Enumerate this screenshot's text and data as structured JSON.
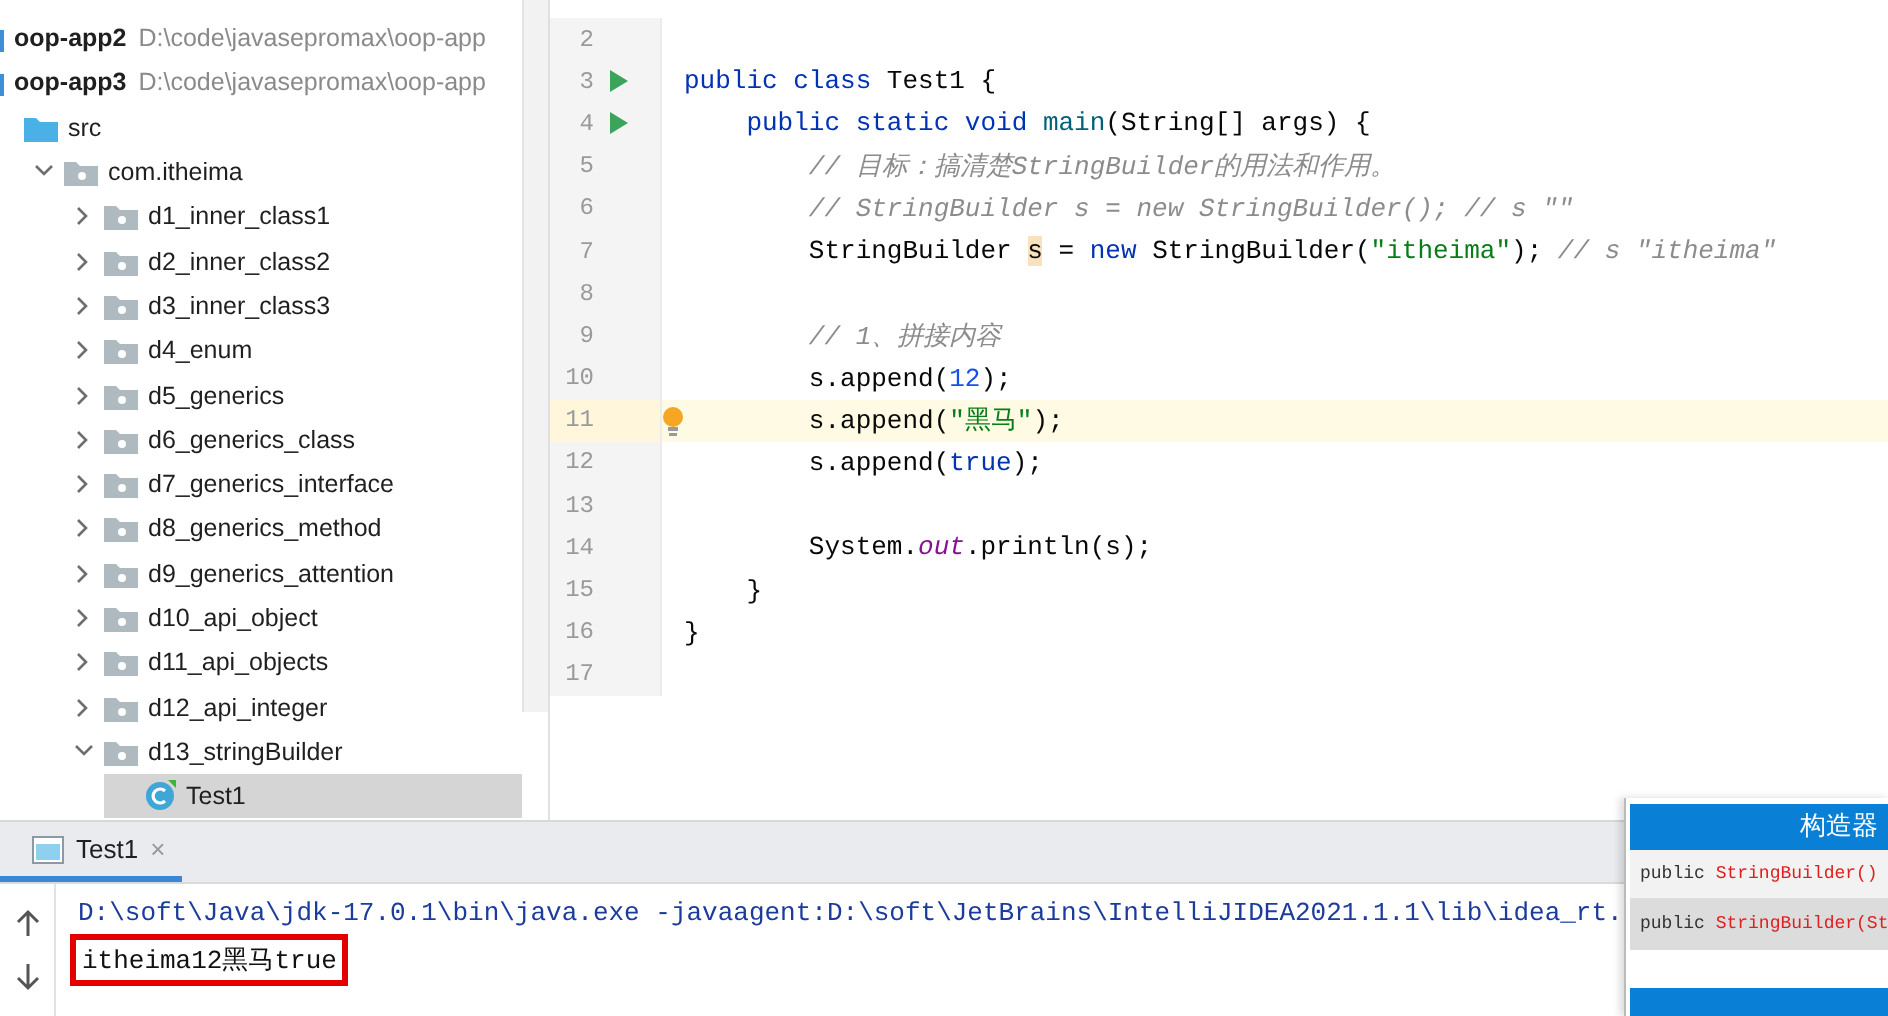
{
  "project_tree": [
    {
      "name": "oop-app2",
      "path": "D:\\code\\javasepromax\\oop-app",
      "kind": "module"
    },
    {
      "name": "oop-app3",
      "path": "D:\\code\\javasepromax\\oop-app",
      "kind": "module",
      "children": [
        {
          "name": "src",
          "kind": "source",
          "children": [
            {
              "name": "com.itheima",
              "kind": "package",
              "expanded": true,
              "children": [
                {
                  "name": "d1_inner_class1",
                  "kind": "package",
                  "expanded": false
                },
                {
                  "name": "d2_inner_class2",
                  "kind": "package",
                  "expanded": false
                },
                {
                  "name": "d3_inner_class3",
                  "kind": "package",
                  "expanded": false
                },
                {
                  "name": "d4_enum",
                  "kind": "package",
                  "expanded": false
                },
                {
                  "name": "d5_generics",
                  "kind": "package",
                  "expanded": false
                },
                {
                  "name": "d6_generics_class",
                  "kind": "package",
                  "expanded": false
                },
                {
                  "name": "d7_generics_interface",
                  "kind": "package",
                  "expanded": false
                },
                {
                  "name": "d8_generics_method",
                  "kind": "package",
                  "expanded": false
                },
                {
                  "name": "d9_generics_attention",
                  "kind": "package",
                  "expanded": false
                },
                {
                  "name": "d10_api_object",
                  "kind": "package",
                  "expanded": false
                },
                {
                  "name": "d11_api_objects",
                  "kind": "package",
                  "expanded": false
                },
                {
                  "name": "d12_api_integer",
                  "kind": "package",
                  "expanded": false
                },
                {
                  "name": "d13_stringBuilder",
                  "kind": "package",
                  "expanded": true,
                  "children": [
                    {
                      "name": "Test1",
                      "kind": "class",
                      "selected": true
                    }
                  ]
                }
              ]
            }
          ]
        }
      ]
    }
  ],
  "editor": {
    "lines": [
      {
        "number": "2",
        "current": false,
        "runnable": false,
        "bulb": false
      },
      {
        "number": "3",
        "current": false,
        "runnable": true,
        "bulb": false,
        "segments": [
          {
            "text": "public class ",
            "kind": "keyword"
          },
          {
            "text": "Test1 {",
            "kind": "plain"
          }
        ]
      },
      {
        "number": "4",
        "current": false,
        "runnable": true,
        "bulb": false,
        "segments": [
          {
            "text": "    public static void ",
            "kind": "keyword"
          },
          {
            "text": "main",
            "kind": "method"
          },
          {
            "text": "(String[] args) {",
            "kind": "plain"
          }
        ]
      },
      {
        "number": "5",
        "current": false,
        "runnable": false,
        "bulb": false,
        "segments": [
          {
            "text": "        // 目标：搞清楚StringBuilder的用法和作用。",
            "kind": "comment"
          }
        ]
      },
      {
        "number": "6",
        "current": false,
        "runnable": false,
        "bulb": false,
        "segments": [
          {
            "text": "        // StringBuilder s = new StringBuilder(); // s \"\"",
            "kind": "comment"
          }
        ]
      },
      {
        "number": "7",
        "current": false,
        "runnable": false,
        "bulb": false,
        "segments": [
          {
            "text": "        StringBuilder ",
            "kind": "plain"
          },
          {
            "text": "s",
            "kind": "highlight"
          },
          {
            "text": " = ",
            "kind": "plain"
          },
          {
            "text": "new ",
            "kind": "keyword"
          },
          {
            "text": "StringBuilder(",
            "kind": "plain"
          },
          {
            "text": "\"itheima\"",
            "kind": "string"
          },
          {
            "text": "); ",
            "kind": "plain"
          },
          {
            "text": "// s \"itheima\"",
            "kind": "comment"
          }
        ]
      },
      {
        "number": "8",
        "current": false,
        "runnable": false,
        "bulb": false
      },
      {
        "number": "9",
        "current": false,
        "runnable": false,
        "bulb": false,
        "segments": [
          {
            "text": "        // 1、拼接内容",
            "kind": "comment"
          }
        ]
      },
      {
        "number": "10",
        "current": false,
        "runnable": false,
        "bulb": false,
        "segments": [
          {
            "text": "        s.append(",
            "kind": "plain"
          },
          {
            "text": "12",
            "kind": "number"
          },
          {
            "text": ");",
            "kind": "plain"
          }
        ]
      },
      {
        "number": "11",
        "current": true,
        "runnable": false,
        "bulb": true,
        "segments": [
          {
            "text": "        s.append(",
            "kind": "plain"
          },
          {
            "text": "\"黑马\"",
            "kind": "string"
          },
          {
            "text": ");",
            "kind": "plain"
          }
        ]
      },
      {
        "number": "12",
        "current": false,
        "runnable": false,
        "bulb": false,
        "segments": [
          {
            "text": "        s.append(",
            "kind": "plain"
          },
          {
            "text": "true",
            "kind": "keyword"
          },
          {
            "text": ");",
            "kind": "plain"
          }
        ]
      },
      {
        "number": "13",
        "current": false,
        "runnable": false,
        "bulb": false
      },
      {
        "number": "14",
        "current": false,
        "runnable": false,
        "bulb": false,
        "segments": [
          {
            "text": "        System.",
            "kind": "plain"
          },
          {
            "text": "out",
            "kind": "field"
          },
          {
            "text": ".println(s);",
            "kind": "plain"
          }
        ]
      },
      {
        "number": "15",
        "current": false,
        "runnable": false,
        "bulb": false,
        "segments": [
          {
            "text": "    }",
            "kind": "plain"
          }
        ]
      },
      {
        "number": "16",
        "current": false,
        "runnable": false,
        "bulb": false,
        "segments": [
          {
            "text": "}",
            "kind": "plain"
          }
        ]
      },
      {
        "number": "17",
        "current": false,
        "runnable": false,
        "bulb": false
      }
    ]
  },
  "run_panel": {
    "tabs": [
      {
        "label": "Test1",
        "selected": true,
        "close": "×"
      }
    ],
    "output": [
      {
        "text": "D:\\soft\\Java\\jdk-17.0.1\\bin\\java.exe -javaagent:D:\\soft\\JetBrains\\IntelliJIDEA2021.1.1\\lib\\idea_rt.",
        "kind": "command",
        "boxed": false
      },
      {
        "text": "itheima12黑马true",
        "kind": "output",
        "boxed": true
      }
    ]
  },
  "popup": {
    "sections": [
      {
        "title": "构造器",
        "items": [
          {
            "modifier": "public",
            "name": "StringBuilder()",
            "selected": false
          },
          {
            "modifier": "public",
            "name": "StringBuilder(St",
            "selected": true
          }
        ]
      }
    ]
  }
}
